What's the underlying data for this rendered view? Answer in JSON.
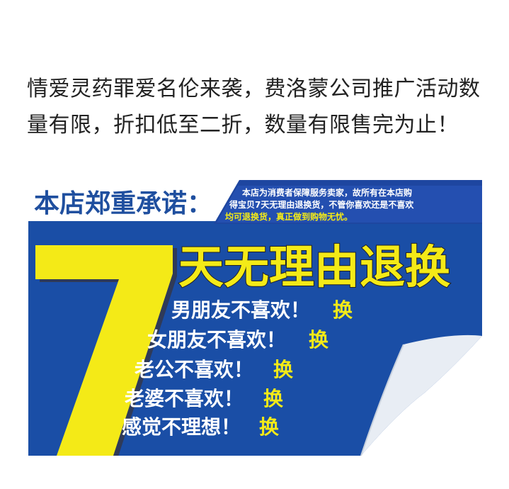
{
  "intro": {
    "text": "情爱灵药罪爱名伦来袭，费洛蒙公司推广活动数量有限，折扣低至二折，数量有限售完为止！"
  },
  "banner": {
    "heading": "本店郑重承诺：",
    "notice_line1": "本店为消费者保障服务卖家，故所有在本店购",
    "notice_line2": "得宝贝7天无理由退换货，不管你喜欢还是不喜欢",
    "notice_line3": "均可退换货，真正做到购物无忧。",
    "big_number": "7",
    "headline": "天无理由退换",
    "reasons": [
      {
        "text": "男朋友不喜欢！",
        "action": "换"
      },
      {
        "text": "女朋友不喜欢！",
        "action": "换"
      },
      {
        "text": "老公不喜欢！",
        "action": "换"
      },
      {
        "text": "老婆不喜欢！",
        "action": "换"
      },
      {
        "text": "感觉不理想！",
        "action": "换"
      }
    ],
    "colors": {
      "blue": "#1a4ea6",
      "yellow": "#f4ea17",
      "heading_blue": "#1f4f9f",
      "white": "#ffffff"
    }
  }
}
